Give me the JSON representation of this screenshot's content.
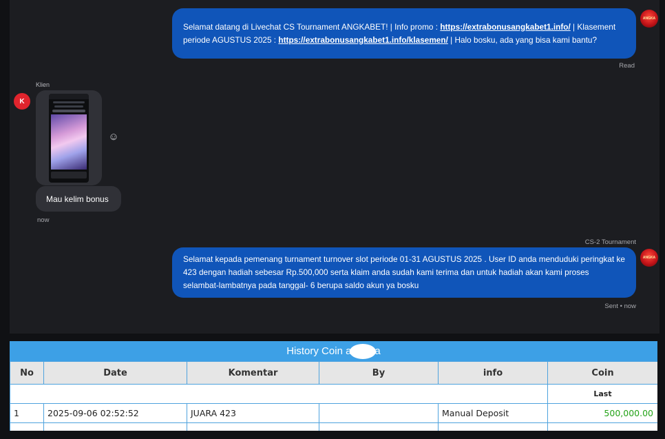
{
  "chat": {
    "agent_avatar_text": "ANGKA",
    "message1": {
      "text_before": "Selamat datang di Livechat CS Tournament ANGKABET! | Info promo : ",
      "link1": "https://extrabonusangkabet1.info/",
      "text_mid": " | Klasement periode AGUSTUS 2025 : ",
      "link2": "https://extrabonusangkabet1.info/klasemen/",
      "text_after": " | Halo bosku, ada yang bisa kami bantu?",
      "status": "Read"
    },
    "client": {
      "name": "Klien",
      "avatar_letter": "K",
      "reaction_icon": "add-reaction-icon",
      "message": "Mau kelim bonus",
      "time": "now"
    },
    "message2": {
      "sender": "CS-2 Tournament",
      "text": "Selamat kepada pemenang turnament turnover slot periode 01-31 AGUSTUS 2025 . User ID anda menduduki peringkat ke 423 dengan hadiah sebesar Rp.500,000 serta klaim anda sudah kami terima dan untuk hadiah akan kami proses selambat-lambatnya pada tanggal- 6 berupa saldo akun ya bosku",
      "status": "Sent • now"
    }
  },
  "history": {
    "title_start": "History Coin a",
    "title_end": "a",
    "columns": [
      "No",
      "Date",
      "Komentar",
      "By",
      "info",
      "Coin"
    ],
    "subheader": "Last",
    "rows": [
      {
        "no": "1",
        "date": "2025-09-06 02:52:52",
        "komentar": "JUARA 423",
        "by": "",
        "info": "Manual Deposit",
        "coin": "500,000.00"
      }
    ]
  },
  "colors": {
    "agent_bubble": "#1055b9",
    "client_bubble": "#303137",
    "table_title": "#3da0e6",
    "coin_positive": "#23a317"
  }
}
